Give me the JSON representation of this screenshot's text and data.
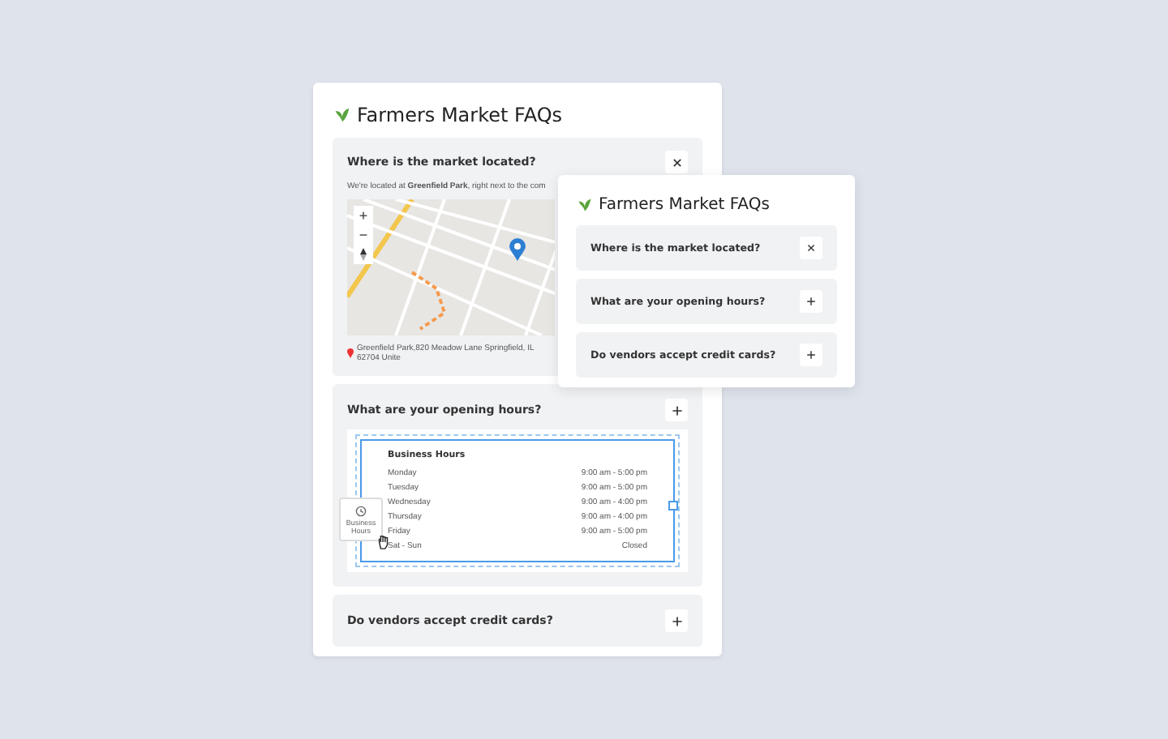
{
  "main_widget": {
    "title": "Farmers Market FAQs",
    "items": [
      {
        "question": "Where is the market located?",
        "expanded": true,
        "kind": "location",
        "intro": "We're located at **Greenfield Park**, right next to the com",
        "map": {
          "controls": [
            "+",
            "−"
          ]
        },
        "address": "Greenfield Park,820 Meadow Lane Springfield, IL 62704 Unite"
      },
      {
        "question": "What are your opening hours?",
        "expanded": false,
        "kind": "hours",
        "hours": {
          "title": "Business Hours",
          "rows": [
            {
              "day": "Monday",
              "time": "9:00 am - 5:00 pm"
            },
            {
              "day": "Tuesday",
              "time": "9:00 am - 5:00 pm"
            },
            {
              "day": "Wednesday",
              "time": "9:00 am - 4:00 pm"
            },
            {
              "day": "Thursday",
              "time": "9:00 am - 4:00 pm"
            },
            {
              "day": "Friday",
              "time": "9:00 am - 5:00 pm"
            },
            {
              "day": "Sat - Sun",
              "time": "Closed"
            }
          ],
          "drag_tile": "Business Hours"
        }
      },
      {
        "question": "Do vendors accept credit cards?",
        "expanded": false
      }
    ]
  },
  "preview_widget": {
    "title": "Farmers Market FAQs",
    "items": [
      {
        "question": "Where is the market located?",
        "expanded": true
      },
      {
        "question": "What are your opening hours?",
        "expanded": false
      },
      {
        "question": "Do vendors accept credit cards?",
        "expanded": false
      }
    ]
  }
}
